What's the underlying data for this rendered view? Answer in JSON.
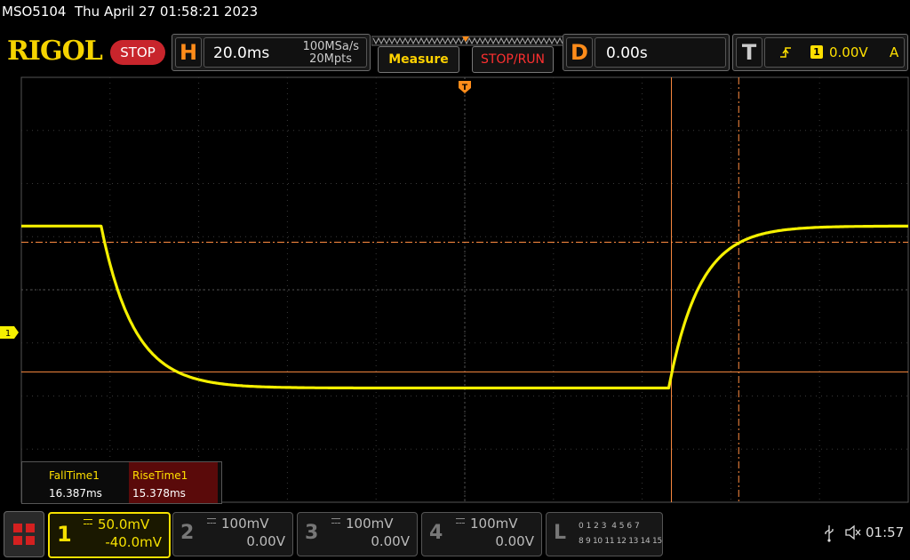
{
  "title_bar": {
    "model": "MSO5104",
    "datetime": "Thu April 27 01:58:21 2023"
  },
  "header": {
    "logo": "RIGOL",
    "run_state": "STOP",
    "horizontal": {
      "letter": "H",
      "timebase": "20.0ms",
      "sample_rate": "100MSa/s",
      "memory_depth": "20Mpts"
    },
    "measure_button": "Measure",
    "stop_run_button": "STOP/RUN",
    "delay": {
      "letter": "D",
      "value": "0.00s"
    },
    "trigger": {
      "letter": "T",
      "source": "1",
      "level": "0.00V",
      "mode": "A"
    }
  },
  "channel_marker": "1",
  "measurements": [
    {
      "name": "FallTime1",
      "value": "16.387ms"
    },
    {
      "name": "RiseTime1",
      "value": "15.378ms"
    }
  ],
  "channels": [
    {
      "number": "1",
      "scale": "50.0mV",
      "offset": "-40.0mV",
      "active": true
    },
    {
      "number": "2",
      "scale": "100mV",
      "offset": "0.00V",
      "active": false
    },
    {
      "number": "3",
      "scale": "100mV",
      "offset": "0.00V",
      "active": false
    },
    {
      "number": "4",
      "scale": "100mV",
      "offset": "0.00V",
      "active": false
    }
  ],
  "logic": {
    "letter": "L",
    "row1": "0 1 2 3  4 5 6 7",
    "row2": "8 9 10 11 12 13 14 15"
  },
  "status": {
    "clock": "01:57"
  },
  "colors": {
    "trace": "#f5f000",
    "cursor": "#ff8c40",
    "accent": "#ff8c1a",
    "stop": "#c8252c"
  },
  "waveform": {
    "h_div": 20,
    "v_div": 8,
    "timebase_ms_per_div": 20,
    "volts_per_div_mv": 50,
    "high_div": 1.2,
    "low_div": -1.85,
    "fall_start_div": -4.1,
    "rise_start_div": 2.3,
    "fall_time_ms": 16.387,
    "rise_time_ms": 15.378
  }
}
